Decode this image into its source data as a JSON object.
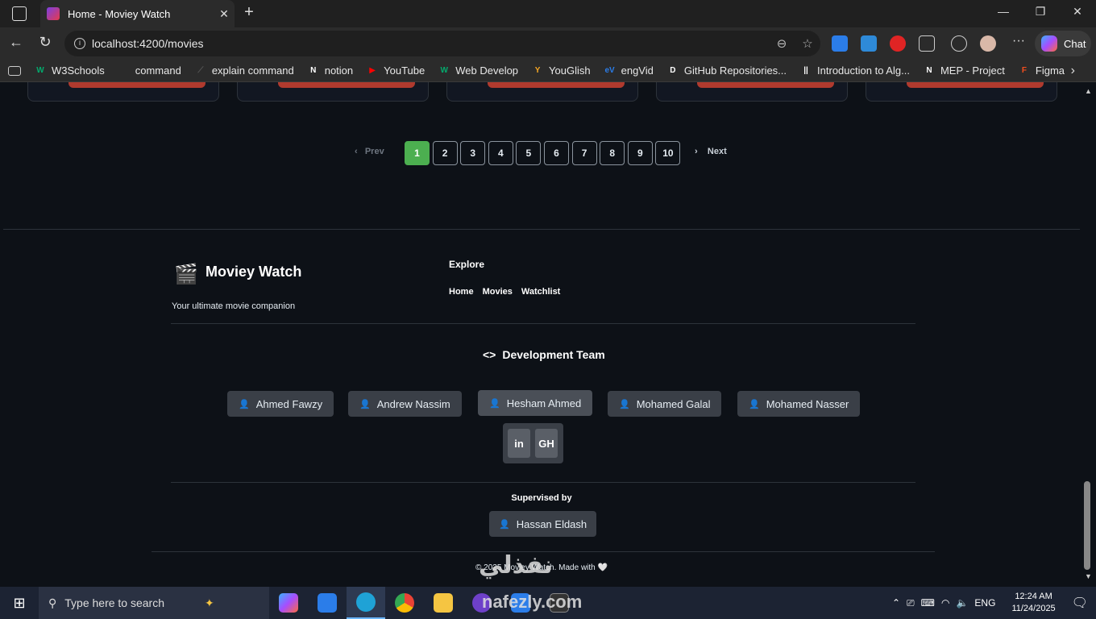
{
  "browser": {
    "tab_title": "Home - Moviey Watch",
    "url": "localhost:4200/movies",
    "chat_label": "Chat",
    "bookmarks": [
      {
        "label": "W3Schools",
        "color": "#04aa6d",
        "glyph": "W"
      },
      {
        "label": "command",
        "color": "#bbbbbb",
        "glyph": ""
      },
      {
        "label": "explain command",
        "color": "#555555",
        "glyph": "⟋"
      },
      {
        "label": "notion",
        "color": "#ffffff",
        "glyph": "N"
      },
      {
        "label": "YouTube",
        "color": "#ff0000",
        "glyph": "▶"
      },
      {
        "label": "Web Develop",
        "color": "#04aa6d",
        "glyph": "W"
      },
      {
        "label": "YouGlish",
        "color": "#f5a623",
        "glyph": "Y"
      },
      {
        "label": "engVid",
        "color": "#2b7de9",
        "glyph": "eV"
      },
      {
        "label": "GitHub Repositories...",
        "color": "#ffffff",
        "glyph": "D"
      },
      {
        "label": "Introduction to Alg...",
        "color": "#ffffff",
        "glyph": "||"
      },
      {
        "label": "MEP - Project",
        "color": "#ffffff",
        "glyph": "N"
      },
      {
        "label": "Figma",
        "color": "#f24e1e",
        "glyph": "F"
      }
    ]
  },
  "pagination": {
    "prev_label": "Prev",
    "next_label": "Next",
    "pages": [
      "1",
      "2",
      "3",
      "4",
      "5",
      "6",
      "7",
      "8",
      "9",
      "10"
    ],
    "active_page": "1",
    "active_color": "#4caf50"
  },
  "footer": {
    "brand_icon": "🎬",
    "brand_name": "Moviey Watch",
    "tagline": "Your ultimate movie companion",
    "explore_title": "Explore",
    "explore_links": [
      "Home",
      "Movies",
      "Watchlist"
    ],
    "dev_title": "Development Team",
    "dev_icon": "<>",
    "team": [
      "Ahmed Fawzy",
      "Andrew Nassim",
      "Hesham Ahmed",
      "Mohamed Galal",
      "Mohamed Nasser"
    ],
    "social": [
      "in",
      "GH"
    ],
    "supervised_title": "Supervised by",
    "supervisor": "Hassan Eldash",
    "copyright": "© 2025 Moviey Watch. Made with 🤍"
  },
  "taskbar": {
    "search_placeholder": "Type here to search",
    "language": "ENG",
    "time": "12:24 AM",
    "date": "11/24/2025"
  },
  "watermark": {
    "arabic": "نفذلي",
    "latin": "nafezly.com"
  }
}
